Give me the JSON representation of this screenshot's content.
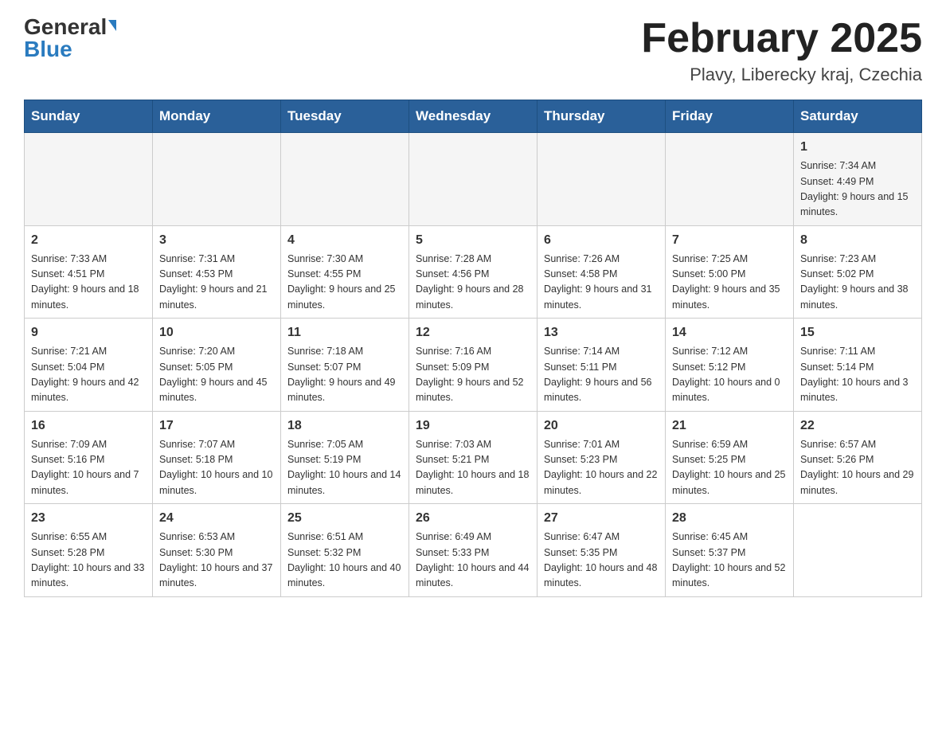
{
  "header": {
    "logo_general": "General",
    "logo_blue": "Blue",
    "month_title": "February 2025",
    "location": "Plavy, Liberecky kraj, Czechia"
  },
  "days_of_week": [
    "Sunday",
    "Monday",
    "Tuesday",
    "Wednesday",
    "Thursday",
    "Friday",
    "Saturday"
  ],
  "weeks": [
    [
      {
        "day": "",
        "sunrise": "",
        "sunset": "",
        "daylight": ""
      },
      {
        "day": "",
        "sunrise": "",
        "sunset": "",
        "daylight": ""
      },
      {
        "day": "",
        "sunrise": "",
        "sunset": "",
        "daylight": ""
      },
      {
        "day": "",
        "sunrise": "",
        "sunset": "",
        "daylight": ""
      },
      {
        "day": "",
        "sunrise": "",
        "sunset": "",
        "daylight": ""
      },
      {
        "day": "",
        "sunrise": "",
        "sunset": "",
        "daylight": ""
      },
      {
        "day": "1",
        "sunrise": "Sunrise: 7:34 AM",
        "sunset": "Sunset: 4:49 PM",
        "daylight": "Daylight: 9 hours and 15 minutes."
      }
    ],
    [
      {
        "day": "2",
        "sunrise": "Sunrise: 7:33 AM",
        "sunset": "Sunset: 4:51 PM",
        "daylight": "Daylight: 9 hours and 18 minutes."
      },
      {
        "day": "3",
        "sunrise": "Sunrise: 7:31 AM",
        "sunset": "Sunset: 4:53 PM",
        "daylight": "Daylight: 9 hours and 21 minutes."
      },
      {
        "day": "4",
        "sunrise": "Sunrise: 7:30 AM",
        "sunset": "Sunset: 4:55 PM",
        "daylight": "Daylight: 9 hours and 25 minutes."
      },
      {
        "day": "5",
        "sunrise": "Sunrise: 7:28 AM",
        "sunset": "Sunset: 4:56 PM",
        "daylight": "Daylight: 9 hours and 28 minutes."
      },
      {
        "day": "6",
        "sunrise": "Sunrise: 7:26 AM",
        "sunset": "Sunset: 4:58 PM",
        "daylight": "Daylight: 9 hours and 31 minutes."
      },
      {
        "day": "7",
        "sunrise": "Sunrise: 7:25 AM",
        "sunset": "Sunset: 5:00 PM",
        "daylight": "Daylight: 9 hours and 35 minutes."
      },
      {
        "day": "8",
        "sunrise": "Sunrise: 7:23 AM",
        "sunset": "Sunset: 5:02 PM",
        "daylight": "Daylight: 9 hours and 38 minutes."
      }
    ],
    [
      {
        "day": "9",
        "sunrise": "Sunrise: 7:21 AM",
        "sunset": "Sunset: 5:04 PM",
        "daylight": "Daylight: 9 hours and 42 minutes."
      },
      {
        "day": "10",
        "sunrise": "Sunrise: 7:20 AM",
        "sunset": "Sunset: 5:05 PM",
        "daylight": "Daylight: 9 hours and 45 minutes."
      },
      {
        "day": "11",
        "sunrise": "Sunrise: 7:18 AM",
        "sunset": "Sunset: 5:07 PM",
        "daylight": "Daylight: 9 hours and 49 minutes."
      },
      {
        "day": "12",
        "sunrise": "Sunrise: 7:16 AM",
        "sunset": "Sunset: 5:09 PM",
        "daylight": "Daylight: 9 hours and 52 minutes."
      },
      {
        "day": "13",
        "sunrise": "Sunrise: 7:14 AM",
        "sunset": "Sunset: 5:11 PM",
        "daylight": "Daylight: 9 hours and 56 minutes."
      },
      {
        "day": "14",
        "sunrise": "Sunrise: 7:12 AM",
        "sunset": "Sunset: 5:12 PM",
        "daylight": "Daylight: 10 hours and 0 minutes."
      },
      {
        "day": "15",
        "sunrise": "Sunrise: 7:11 AM",
        "sunset": "Sunset: 5:14 PM",
        "daylight": "Daylight: 10 hours and 3 minutes."
      }
    ],
    [
      {
        "day": "16",
        "sunrise": "Sunrise: 7:09 AM",
        "sunset": "Sunset: 5:16 PM",
        "daylight": "Daylight: 10 hours and 7 minutes."
      },
      {
        "day": "17",
        "sunrise": "Sunrise: 7:07 AM",
        "sunset": "Sunset: 5:18 PM",
        "daylight": "Daylight: 10 hours and 10 minutes."
      },
      {
        "day": "18",
        "sunrise": "Sunrise: 7:05 AM",
        "sunset": "Sunset: 5:19 PM",
        "daylight": "Daylight: 10 hours and 14 minutes."
      },
      {
        "day": "19",
        "sunrise": "Sunrise: 7:03 AM",
        "sunset": "Sunset: 5:21 PM",
        "daylight": "Daylight: 10 hours and 18 minutes."
      },
      {
        "day": "20",
        "sunrise": "Sunrise: 7:01 AM",
        "sunset": "Sunset: 5:23 PM",
        "daylight": "Daylight: 10 hours and 22 minutes."
      },
      {
        "day": "21",
        "sunrise": "Sunrise: 6:59 AM",
        "sunset": "Sunset: 5:25 PM",
        "daylight": "Daylight: 10 hours and 25 minutes."
      },
      {
        "day": "22",
        "sunrise": "Sunrise: 6:57 AM",
        "sunset": "Sunset: 5:26 PM",
        "daylight": "Daylight: 10 hours and 29 minutes."
      }
    ],
    [
      {
        "day": "23",
        "sunrise": "Sunrise: 6:55 AM",
        "sunset": "Sunset: 5:28 PM",
        "daylight": "Daylight: 10 hours and 33 minutes."
      },
      {
        "day": "24",
        "sunrise": "Sunrise: 6:53 AM",
        "sunset": "Sunset: 5:30 PM",
        "daylight": "Daylight: 10 hours and 37 minutes."
      },
      {
        "day": "25",
        "sunrise": "Sunrise: 6:51 AM",
        "sunset": "Sunset: 5:32 PM",
        "daylight": "Daylight: 10 hours and 40 minutes."
      },
      {
        "day": "26",
        "sunrise": "Sunrise: 6:49 AM",
        "sunset": "Sunset: 5:33 PM",
        "daylight": "Daylight: 10 hours and 44 minutes."
      },
      {
        "day": "27",
        "sunrise": "Sunrise: 6:47 AM",
        "sunset": "Sunset: 5:35 PM",
        "daylight": "Daylight: 10 hours and 48 minutes."
      },
      {
        "day": "28",
        "sunrise": "Sunrise: 6:45 AM",
        "sunset": "Sunset: 5:37 PM",
        "daylight": "Daylight: 10 hours and 52 minutes."
      },
      {
        "day": "",
        "sunrise": "",
        "sunset": "",
        "daylight": ""
      }
    ]
  ]
}
